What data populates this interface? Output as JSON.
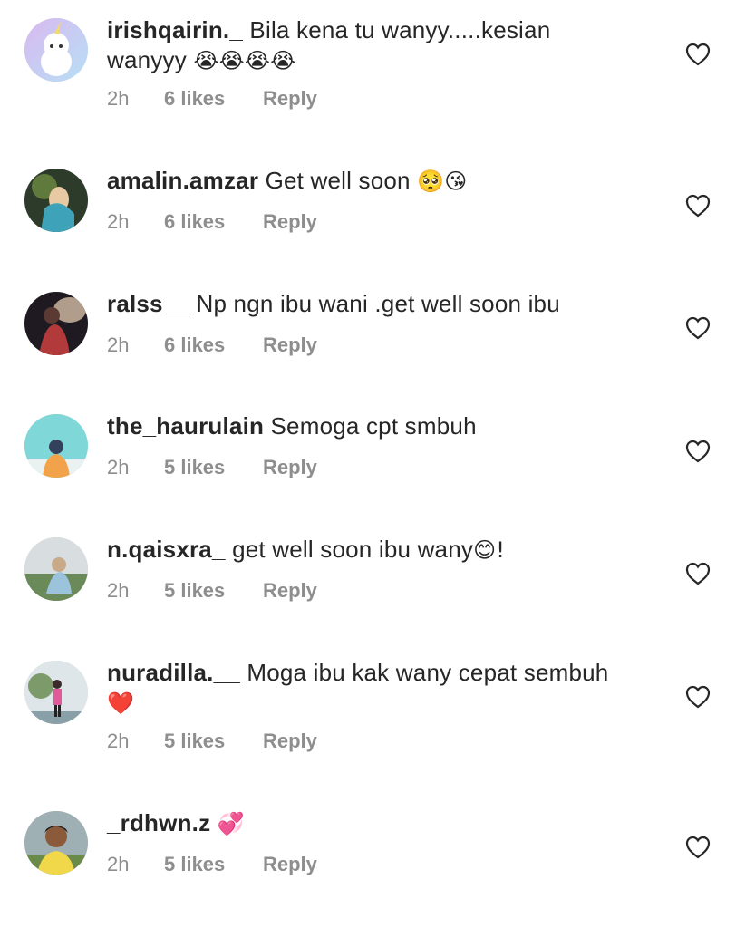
{
  "comments": [
    {
      "username": "irishqairin._",
      "text": "Bila kena tu wanyy.....kesian wanyyy",
      "emoji": "😭😭😭😭",
      "time": "2h",
      "likes": "6 likes",
      "reply": "Reply"
    },
    {
      "username": "amalin.amzar",
      "text": "Get well soon",
      "emoji": "🥺😘",
      "time": "2h",
      "likes": "6 likes",
      "reply": "Reply"
    },
    {
      "username": "ralss__",
      "text": "Np ngn ibu wani .get well soon ibu",
      "emoji": "",
      "time": "2h",
      "likes": "6 likes",
      "reply": "Reply"
    },
    {
      "username": "the_haurulain",
      "text": "Semoga cpt smbuh",
      "emoji": "",
      "time": "2h",
      "likes": "5 likes",
      "reply": "Reply"
    },
    {
      "username": "n.qaisxra_",
      "text": "get well soon ibu wany",
      "emoji": "😊!",
      "time": "2h",
      "likes": "5 likes",
      "reply": "Reply"
    },
    {
      "username": "nuradilla.__",
      "text": "Moga ibu kak wany cepat sembuh",
      "emoji": "❤️",
      "time": "2h",
      "likes": "5 likes",
      "reply": "Reply"
    },
    {
      "username": "_rdhwn.z",
      "text": "",
      "emoji": "💞",
      "time": "2h",
      "likes": "5 likes",
      "reply": "Reply"
    }
  ],
  "icons": {
    "like": "heart-outline-icon"
  },
  "colors": {
    "username": "#262626",
    "meta": "#8e8e8e",
    "background": "#ffffff"
  }
}
